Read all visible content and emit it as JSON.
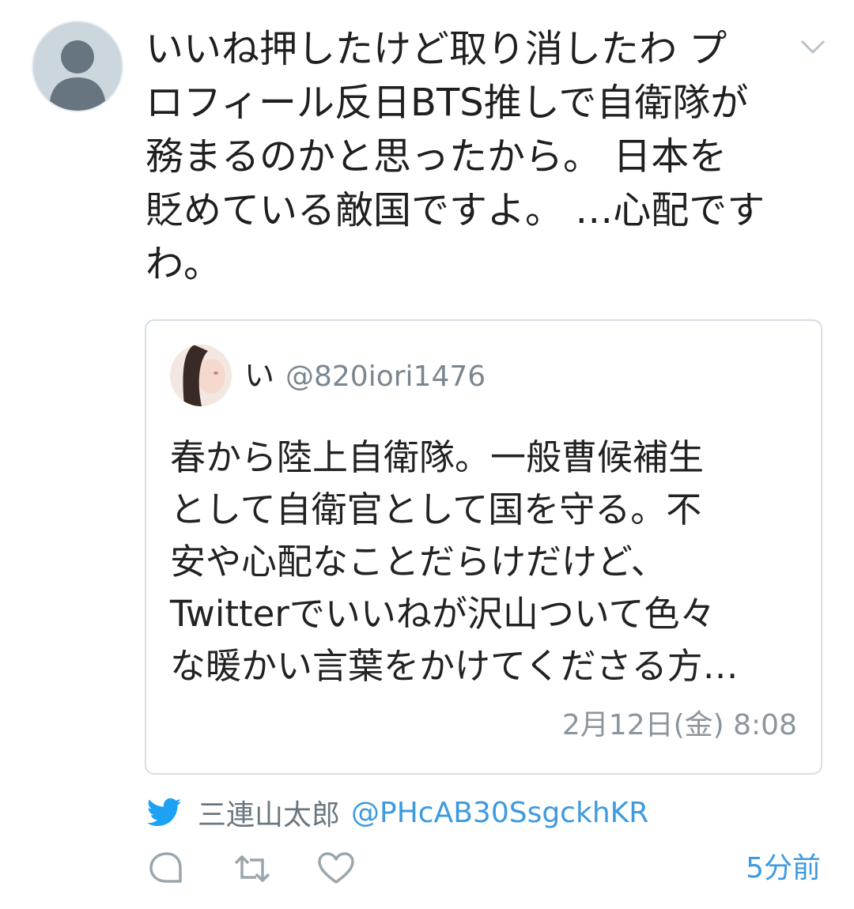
{
  "tweet": {
    "text": "いいね押したけど取り消したわ プロフィール反日BTS推しで自衛隊が務まるのかと思ったから。 日本を貶めている敵国ですよ。 …心配ですわ。",
    "lines": [
      "いいね押したけど取り消したわ プ",
      "ロフィール反日BTS推しで自衛隊が",
      "務まるのかと思ったから。 日本を",
      "貶めている敵国ですよ。 …心配です",
      "わ。"
    ],
    "avatar_icon": "default-user-avatar-icon",
    "menu_icon": "chevron-down-icon"
  },
  "quoted_tweet": {
    "name": "い",
    "handle": "@820iori1476",
    "text_lines": [
      "春から陸上自衛隊。一般曹候補生",
      "として自衛官として国を守る。不",
      "安や心配なことだらけだけど、",
      "Twitterでいいねが沢山ついて色々",
      "な暖かい言葉をかけてくださる方…"
    ],
    "time": "2月12日(金) 8:08"
  },
  "via": {
    "icon": "twitter-bird-icon",
    "name": "三連山太郎",
    "handle": "@PHcAB30SsgckhKR"
  },
  "actions": {
    "reply_icon": "reply-icon",
    "retweet_icon": "retweet-icon",
    "like_icon": "heart-icon",
    "timestamp": "5分前"
  },
  "colors": {
    "accent": "#3d9ae0",
    "border": "#d6dde3",
    "muted_text": "#7a8791"
  }
}
